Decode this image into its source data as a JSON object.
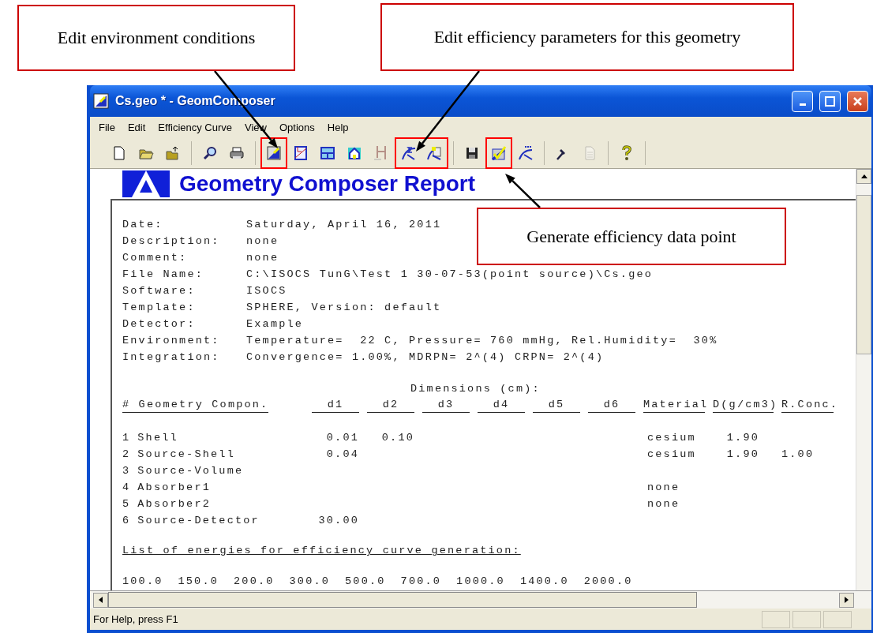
{
  "callouts": [
    {
      "text": "Edit environment conditions"
    },
    {
      "text": "Edit efficiency parameters for this geometry"
    },
    {
      "text": "Generate efficiency data point"
    }
  ],
  "window": {
    "title": "Cs.geo * - GeomComposer"
  },
  "menu": [
    "File",
    "Edit",
    "Efficiency Curve",
    "View",
    "Options",
    "Help"
  ],
  "toolbar": {
    "groups": [
      {
        "buttons": [
          {
            "disabled": false,
            "marked": false
          },
          {
            "disabled": false,
            "marked": false
          },
          {
            "disabled": false,
            "marked": false
          }
        ]
      },
      {
        "buttons": [
          {
            "disabled": false,
            "marked": false
          },
          {
            "disabled": false,
            "marked": false
          }
        ]
      },
      {
        "buttons": [
          {
            "disabled": false,
            "marked": true
          },
          {
            "disabled": false,
            "marked": false
          },
          {
            "disabled": false,
            "marked": false
          },
          {
            "disabled": false,
            "marked": false
          },
          {
            "disabled": true,
            "marked": false
          },
          {
            "disabled": false,
            "marked": true
          },
          {
            "disabled": false,
            "marked": true
          }
        ]
      },
      {
        "buttons": [
          {
            "disabled": false,
            "marked": false
          },
          {
            "disabled": false,
            "marked": true
          },
          {
            "disabled": false,
            "marked": false
          }
        ]
      },
      {
        "buttons": [
          {
            "disabled": false,
            "marked": false
          },
          {
            "disabled": true,
            "marked": false
          }
        ]
      },
      {
        "buttons": [
          {
            "disabled": false,
            "marked": false
          }
        ]
      }
    ]
  },
  "report": {
    "title": "Geometry Composer Report",
    "info": [
      {
        "label": "Date:",
        "value": "Saturday, April 16, 2011"
      },
      {
        "label": "Description:",
        "value": "none"
      },
      {
        "label": "Comment:",
        "value": "none"
      },
      {
        "label": "File Name:",
        "value": "C:\\ISOCS TunG\\Test 1 30-07-53(point source)\\Cs.geo"
      },
      {
        "label": "Software:",
        "value": "ISOCS"
      },
      {
        "label": "Template:",
        "value": "SPHERE, Version: default"
      },
      {
        "label": "Detector:",
        "value": "Example"
      },
      {
        "label": "Environment:",
        "value": "Temperature=  22 C, Pressure= 760 mmHg, Rel.Humidity=  30%"
      },
      {
        "label": "Integration:",
        "value": "Convergence= 1.00%, MDRPN= 2^(4) CRPN= 2^(4)"
      }
    ],
    "dimensions_heading": "Dimensions (cm):",
    "table": {
      "columns": [
        "# Geometry Compon.",
        "d1",
        "d2",
        "d3",
        "d4",
        "d5",
        "d6",
        "Material",
        "D(g/cm3)",
        "R.Conc."
      ],
      "rows": [
        {
          "number": "1",
          "component": "Shell",
          "d1": "0.01",
          "d2": "0.10",
          "material": "cesium",
          "density": "1.90"
        },
        {
          "number": "2",
          "component": "Source-Shell",
          "d1": "0.04",
          "material": "cesium",
          "density": "1.90",
          "r_conc": "1.00"
        },
        {
          "number": "3",
          "component": "Source-Volume"
        },
        {
          "number": "4",
          "component": "Absorber1",
          "material": "none"
        },
        {
          "number": "5",
          "component": "Absorber2",
          "material": "none"
        },
        {
          "number": "6",
          "component": "Source-Detector",
          "d1": "30.00"
        }
      ]
    },
    "energies_heading": "List of energies for efficiency curve generation:",
    "energies": [
      "100.0",
      "150.0",
      "200.0",
      "300.0",
      "500.0",
      "700.0",
      "1000.0",
      "1400.0",
      "2000.0"
    ]
  },
  "status_bar": {
    "text": "For Help, press F1"
  }
}
